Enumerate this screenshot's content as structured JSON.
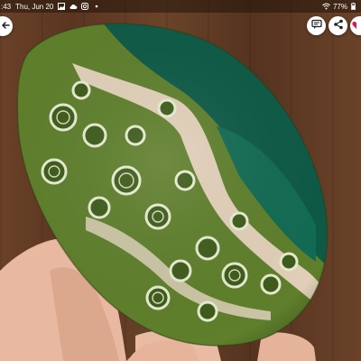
{
  "status_bar": {
    "time": ":43",
    "date": "Thu, Jun 20",
    "battery": "77%",
    "notification_icons": [
      "gallery-icon",
      "cloud-icon",
      "instagram-icon",
      "dot-icon"
    ]
  },
  "toolbar": {
    "back_icon": "arrow-left-icon",
    "actions": [
      "comments-icon",
      "share-icon",
      "heart-icon"
    ]
  },
  "photo": {
    "subject": "ocean-jasper-palm-stone"
  },
  "colors": {
    "heart": "#d81b4a",
    "wood": "#5e3a22",
    "stone_green": "#5a7a2a",
    "stone_teal": "#0d5a45"
  }
}
